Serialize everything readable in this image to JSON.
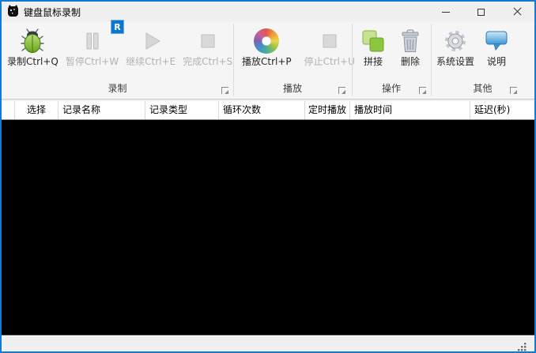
{
  "colors": {
    "accent": "#1379d2",
    "titlebar_bg": "#f0f0f0",
    "ribbon_bg": "#f5f5f5",
    "header_bg": "#ffffff",
    "body_bg": "#000000",
    "statusbar_bg": "#f0f0f0",
    "keytip_bg": "#0c76d0",
    "enabled_text": "#262626",
    "disabled_text": "#b2b2b2"
  },
  "window": {
    "title": "键盘鼠标录制"
  },
  "keytip": {
    "label": "R"
  },
  "ribbon": {
    "groups": [
      {
        "label": "录制",
        "buttons": [
          {
            "label": "录制Ctrl+Q",
            "icon": "bug-record-icon",
            "enabled": true
          },
          {
            "label": "暂停Ctrl+W",
            "icon": "pause-icon",
            "enabled": false
          },
          {
            "label": "继续Ctrl+E",
            "icon": "play-icon",
            "enabled": false
          },
          {
            "label": "完成Ctrl+S",
            "icon": "stop-icon",
            "enabled": false
          }
        ]
      },
      {
        "label": "播放",
        "buttons": [
          {
            "label": "播放Ctrl+P",
            "icon": "color-wheel-icon",
            "enabled": true
          },
          {
            "label": "停止Ctrl+U",
            "icon": "stop-icon",
            "enabled": false
          }
        ]
      },
      {
        "label": "操作",
        "buttons": [
          {
            "label": "拼接",
            "icon": "merge-squares-icon",
            "enabled": true
          },
          {
            "label": "删除",
            "icon": "trash-icon",
            "enabled": true
          }
        ]
      },
      {
        "label": "其他",
        "buttons": [
          {
            "label": "系统设置",
            "icon": "gear-icon",
            "enabled": true
          },
          {
            "label": "说明",
            "icon": "speech-bubble-icon",
            "enabled": true
          }
        ]
      }
    ]
  },
  "table": {
    "columns": [
      {
        "label": ""
      },
      {
        "label": "选择"
      },
      {
        "label": "记录名称"
      },
      {
        "label": "记录类型"
      },
      {
        "label": "循环次数"
      },
      {
        "label": "定时播放"
      },
      {
        "label": "播放时间"
      },
      {
        "label": "延迟(秒)"
      }
    ],
    "rows": []
  }
}
